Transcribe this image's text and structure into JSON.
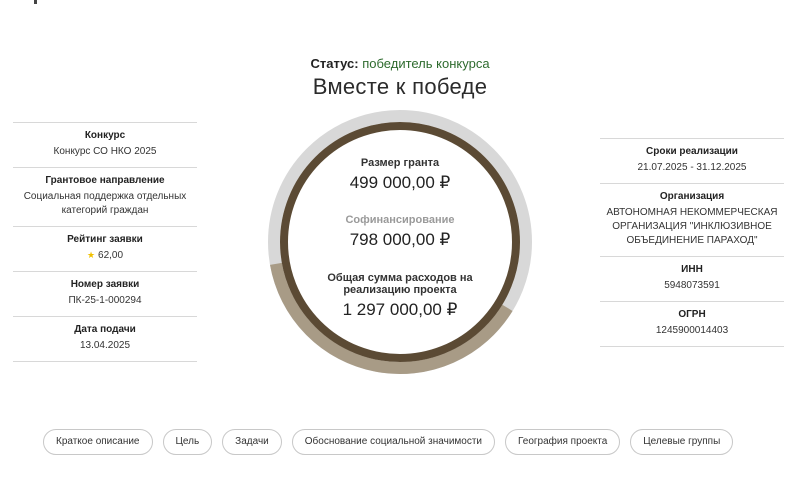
{
  "status": {
    "label": "Статус:",
    "value": "победитель конкурса"
  },
  "project_title": "Вместе к победе",
  "left_info": [
    {
      "label": "Конкурс",
      "value": "Конкурс СО НКО 2025"
    },
    {
      "label": "Грантовое направление",
      "value": "Социальная поддержка отдельных категорий граждан"
    },
    {
      "label": "Рейтинг заявки",
      "value": "62,00",
      "icon": "star-icon"
    },
    {
      "label": "Номер заявки",
      "value": "ПК-25-1-000294"
    },
    {
      "label": "Дата подачи",
      "value": "13.04.2025"
    }
  ],
  "right_info": [
    {
      "label": "Сроки реализации",
      "value": "21.07.2025 - 31.12.2025"
    },
    {
      "label": "Организация",
      "value": "АВТОНОМНАЯ НЕКОММЕРЧЕСКАЯ ОРГАНИЗАЦИЯ \"ИНКЛЮЗИВНОЕ ОБЪЕДИНЕНИЕ ПАРАХОД\""
    },
    {
      "label": "ИНН",
      "value": "5948073591"
    },
    {
      "label": "ОГРН",
      "value": "1245900014403"
    }
  ],
  "finance": {
    "grant_label": "Размер гранта",
    "grant_amount": "499 000,00 ₽",
    "cofinance_label": "Софинансирование",
    "cofinance_amount": "798 000,00 ₽",
    "total_label": "Общая сумма расходов на реализацию проекта",
    "total_amount": "1 297 000,00 ₽"
  },
  "ring": {
    "grant_value": 499000,
    "cofinance_value": 798000,
    "colors": {
      "inner": "#5b4a34",
      "grant": "#a89b86",
      "cofinance": "#d8d8d8"
    }
  },
  "tabs": [
    {
      "label": "Краткое описание"
    },
    {
      "label": "Цель"
    },
    {
      "label": "Задачи"
    },
    {
      "label": "Обоснование социальной значимости"
    },
    {
      "label": "География проекта"
    },
    {
      "label": "Целевые группы"
    }
  ]
}
